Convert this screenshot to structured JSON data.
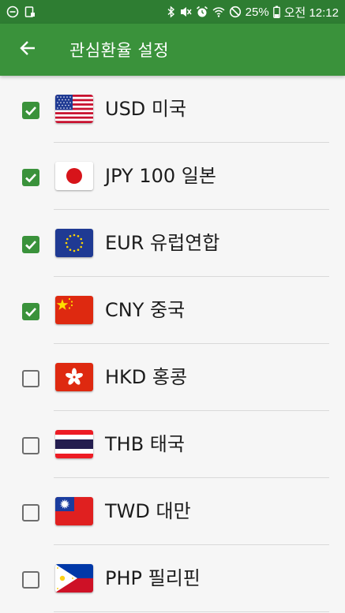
{
  "status_bar": {
    "battery": "25%",
    "time": "오전 12:12"
  },
  "header": {
    "title": "관심환율 설정"
  },
  "colors": {
    "primary": "#3a923b",
    "status_bar": "#2e7d32",
    "background": "#f6f6f6"
  },
  "currencies": [
    {
      "label": "USD 미국",
      "checked": true,
      "flag": "us-flag-icon"
    },
    {
      "label": "JPY 100 일본",
      "checked": true,
      "flag": "japan-flag-icon"
    },
    {
      "label": "EUR 유럽연합",
      "checked": true,
      "flag": "eu-flag-icon"
    },
    {
      "label": "CNY 중국",
      "checked": true,
      "flag": "china-flag-icon"
    },
    {
      "label": "HKD 홍콩",
      "checked": false,
      "flag": "hongkong-flag-icon"
    },
    {
      "label": "THB 태국",
      "checked": false,
      "flag": "thailand-flag-icon"
    },
    {
      "label": "TWD 대만",
      "checked": false,
      "flag": "taiwan-flag-icon"
    },
    {
      "label": "PHP 필리핀",
      "checked": false,
      "flag": "philippines-flag-icon"
    }
  ]
}
